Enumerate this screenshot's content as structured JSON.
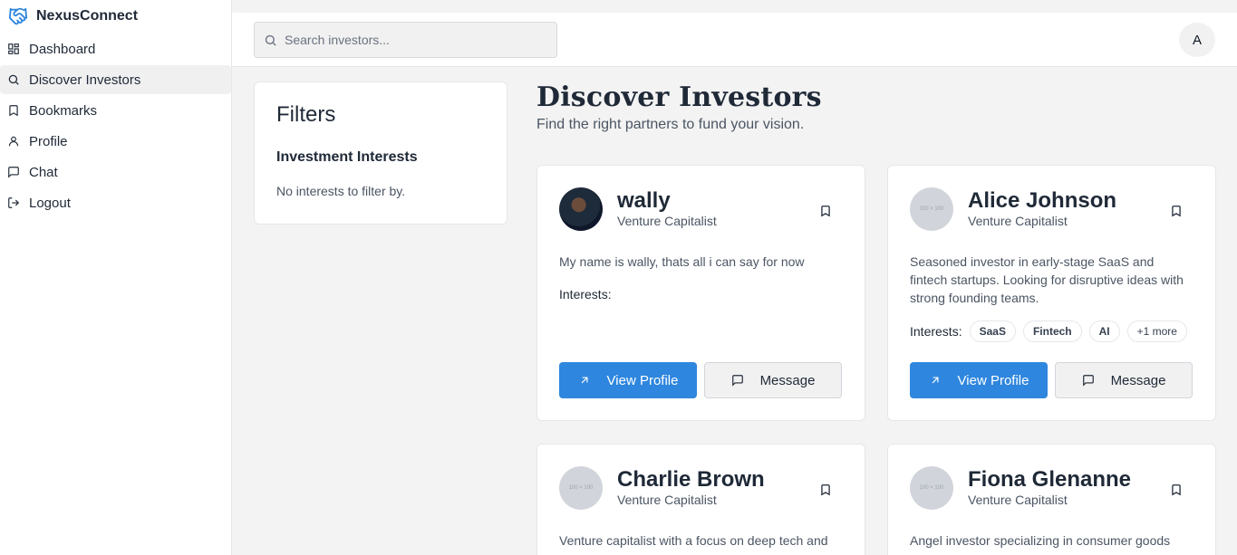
{
  "brand": {
    "name": "NexusConnect",
    "icon": "handshake-icon"
  },
  "sidebar": {
    "items": [
      {
        "label": "Dashboard",
        "icon": "grid-icon",
        "active": false
      },
      {
        "label": "Discover Investors",
        "icon": "search-icon",
        "active": true
      },
      {
        "label": "Bookmarks",
        "icon": "bookmark-icon",
        "active": false
      },
      {
        "label": "Profile",
        "icon": "user-icon",
        "active": false
      },
      {
        "label": "Chat",
        "icon": "chat-icon",
        "active": false
      },
      {
        "label": "Logout",
        "icon": "logout-icon",
        "active": false
      }
    ]
  },
  "search": {
    "placeholder": "Search investors..."
  },
  "user": {
    "initial": "A"
  },
  "filters": {
    "title": "Filters",
    "section_title": "Investment Interests",
    "empty_text": "No interests to filter by."
  },
  "page": {
    "title": "Discover Investors",
    "subtitle": "Find the right partners to fund your vision."
  },
  "labels": {
    "interests": "Interests:",
    "view_profile": "View Profile",
    "message": "Message",
    "placeholder_avatar": "100 × 100"
  },
  "investors": [
    {
      "name": "wally",
      "role": "Venture Capitalist",
      "bio": "My name is wally, thats all i can say for now",
      "tags": [],
      "has_photo": true
    },
    {
      "name": "Alice Johnson",
      "role": "Venture Capitalist",
      "bio": "Seasoned investor in early-stage SaaS and fintech startups. Looking for disruptive ideas with strong founding teams.",
      "tags": [
        "SaaS",
        "Fintech",
        "AI"
      ],
      "more": "+1 more",
      "has_photo": false
    },
    {
      "name": "Charlie Brown",
      "role": "Venture Capitalist",
      "bio": "Venture capitalist with a focus on deep tech and sustainable energy. Passionate about",
      "tags": [],
      "has_photo": false
    },
    {
      "name": "Fiona Glenanne",
      "role": "Venture Capitalist",
      "bio": "Angel investor specializing in consumer goods and e-commerce. Enjoys working with first",
      "tags": [],
      "has_photo": false
    }
  ],
  "colors": {
    "accent": "#2e86de",
    "background": "#f3f3f3"
  }
}
